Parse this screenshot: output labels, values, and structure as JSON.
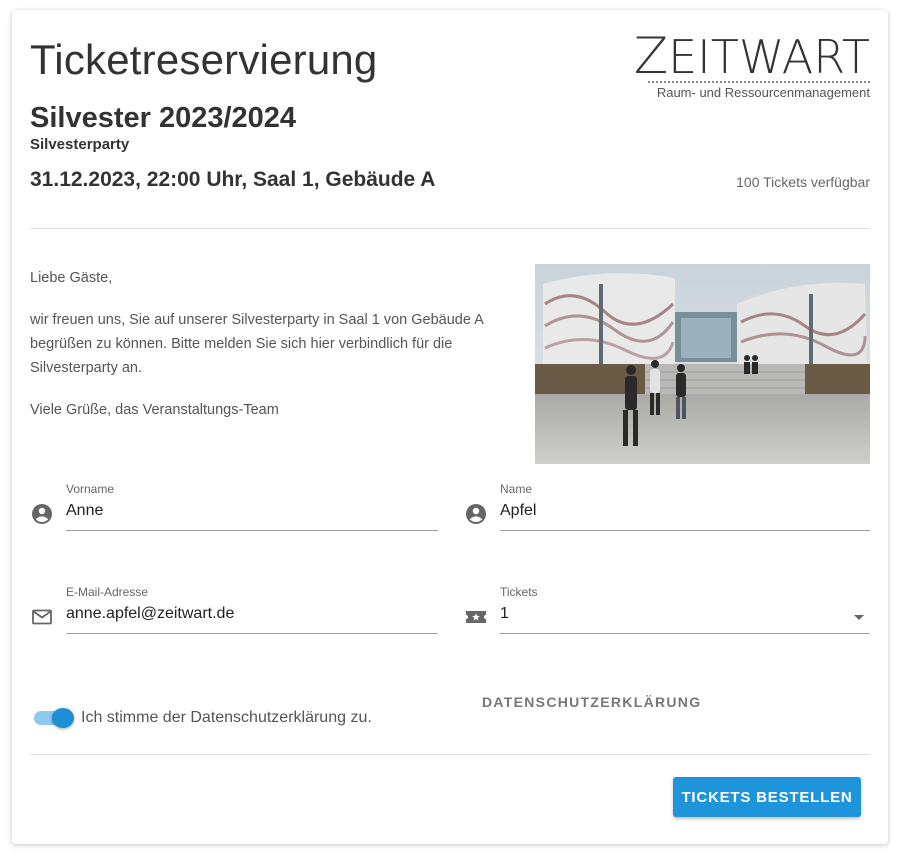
{
  "header": {
    "title": "Ticketreservierung",
    "logo": {
      "wordmark_z": "Z",
      "wordmark_rest": "EITWART",
      "subtitle": "Raum- und Ressourcenmanagement"
    }
  },
  "event": {
    "title": "Silvester 2023/2024",
    "subtitle": "Silvesterparty",
    "datetime_location": "31.12.2023, 22:00 Uhr, Saal 1, Gebäude A",
    "availability": "100 Tickets verfügbar"
  },
  "intro": {
    "greeting": "Liebe Gäste,",
    "body": "wir freuen uns, Sie auf unserer Silvesterparty in Saal 1 von Gebäude A begrüßen zu können. Bitte melden Sie sich hier verbindlich für die Silvesterparty an.",
    "closing": "Viele Grüße, das Veranstaltungs-Team"
  },
  "form": {
    "vorname": {
      "label": "Vorname",
      "value": "Anne",
      "icon": "account-circle-icon"
    },
    "name": {
      "label": "Name",
      "value": "Apfel",
      "icon": "account-circle-icon"
    },
    "email": {
      "label": "E-Mail-Adresse",
      "value": "anne.apfel@zeitwart.de",
      "icon": "mail-icon"
    },
    "tickets": {
      "label": "Tickets",
      "value": "1",
      "icon": "ticket-icon"
    },
    "consent": {
      "label": "Ich stimme der Datenschutzerklärung zu.",
      "checked": true
    },
    "privacy_link": "DATENSCHUTZERKLÄRUNG",
    "submit": "TICKETS BESTELLEN"
  },
  "colors": {
    "accent": "#1e95da",
    "toggle_track": "#8ec9ee",
    "text": "#333333"
  }
}
